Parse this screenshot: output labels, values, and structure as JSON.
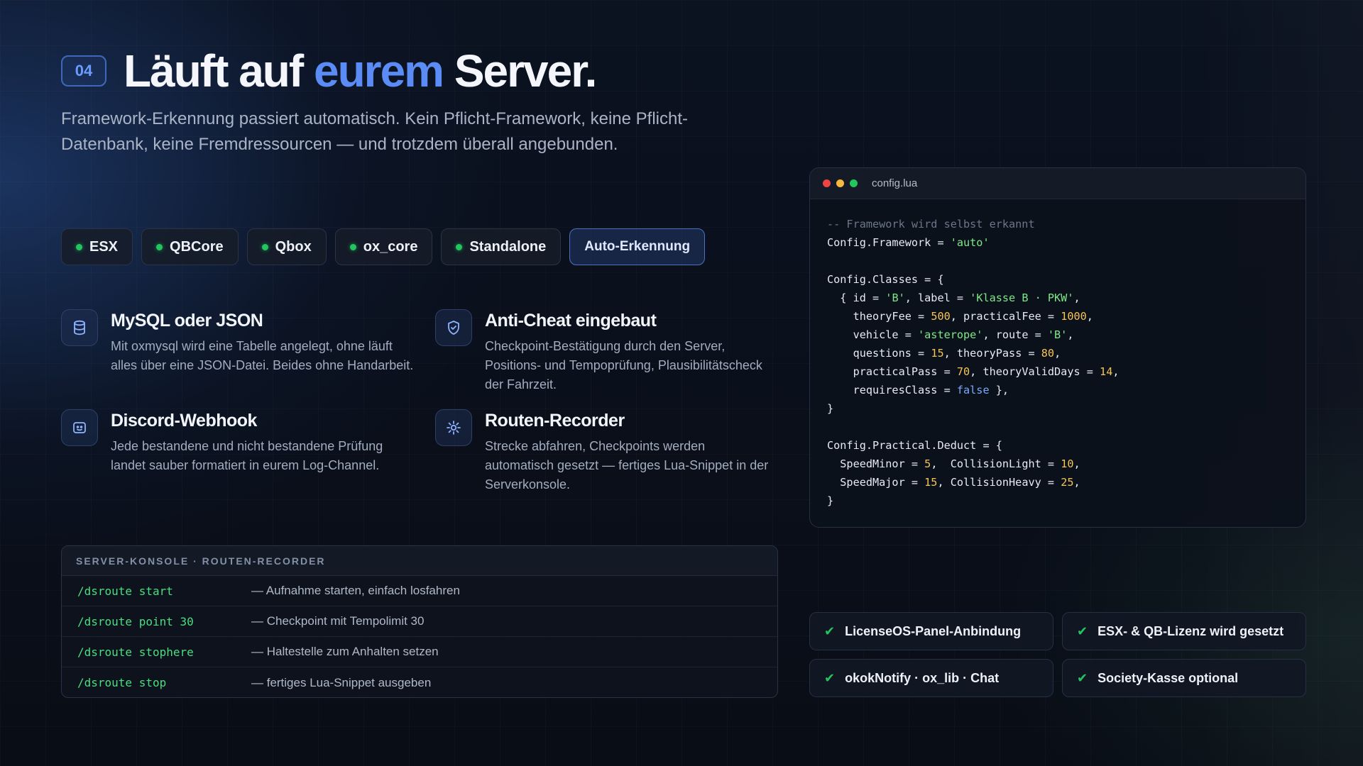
{
  "header": {
    "section_number": "04",
    "title_part1": "Läuft auf ",
    "title_accent": "eurem",
    "title_part2": " Server.",
    "subtitle": "Framework-Erkennung passiert automatisch. Kein Pflicht-Framework, keine Pflicht-Datenbank, keine Fremdressourcen — und trotzdem überall angebunden."
  },
  "frameworks": [
    {
      "label": "ESX"
    },
    {
      "label": "QBCore"
    },
    {
      "label": "Qbox"
    },
    {
      "label": "ox_core"
    },
    {
      "label": "Standalone"
    }
  ],
  "auto_chip": "Auto-Erkennung",
  "features": [
    {
      "icon": "database-icon",
      "title": "MySQL oder JSON",
      "text": "Mit oxmysql wird eine Tabelle angelegt, ohne läuft alles über eine JSON-Datei. Beides ohne Handarbeit."
    },
    {
      "icon": "shield-icon",
      "title": "Anti-Cheat eingebaut",
      "text": "Checkpoint-Bestätigung durch den Server, Positions- und Tempoprüfung, Plausibilitätscheck der Fahrzeit."
    },
    {
      "icon": "discord-icon",
      "title": "Discord-Webhook",
      "text": "Jede bestandene und nicht bestandene Prüfung landet sauber formatiert in eurem Log-Channel."
    },
    {
      "icon": "route-icon",
      "title": "Routen-Recorder",
      "text": "Strecke abfahren, Checkpoints werden automatisch gesetzt — fertiges Lua-Snippet in der Serverkonsole."
    }
  ],
  "console": {
    "header": "SERVER-KONSOLE · ROUTEN-RECORDER",
    "rows": [
      {
        "cmd": "/dsroute start",
        "desc": "— Aufnahme starten, einfach losfahren"
      },
      {
        "cmd": "/dsroute point 30",
        "desc": "— Checkpoint mit Tempolimit 30"
      },
      {
        "cmd": "/dsroute stophere",
        "desc": "— Haltestelle zum Anhalten setzen"
      },
      {
        "cmd": "/dsroute stop",
        "desc": "— fertiges Lua-Snippet ausgeben"
      }
    ]
  },
  "code_window": {
    "filename": "config.lua",
    "colors": {
      "red": "#ef4444",
      "yellow": "#f5b93b",
      "green": "#22c55e"
    },
    "lines": [
      [
        {
          "t": "-- Framework wird selbst erkannt",
          "c": "cm"
        }
      ],
      [
        {
          "t": "Config.Framework = "
        },
        {
          "t": "'auto'",
          "c": "st"
        }
      ],
      [],
      [
        {
          "t": "Config.Classes = {"
        }
      ],
      [
        {
          "t": "  { id = "
        },
        {
          "t": "'B'",
          "c": "st"
        },
        {
          "t": ", label = "
        },
        {
          "t": "'Klasse B · PKW'",
          "c": "st"
        },
        {
          "t": ","
        }
      ],
      [
        {
          "t": "    theoryFee = "
        },
        {
          "t": "500",
          "c": "nu"
        },
        {
          "t": ", practicalFee = "
        },
        {
          "t": "1000",
          "c": "nu"
        },
        {
          "t": ","
        }
      ],
      [
        {
          "t": "    vehicle = "
        },
        {
          "t": "'asterope'",
          "c": "st"
        },
        {
          "t": ", route = "
        },
        {
          "t": "'B'",
          "c": "st"
        },
        {
          "t": ","
        }
      ],
      [
        {
          "t": "    questions = "
        },
        {
          "t": "15",
          "c": "nu"
        },
        {
          "t": ", theoryPass = "
        },
        {
          "t": "80",
          "c": "nu"
        },
        {
          "t": ","
        }
      ],
      [
        {
          "t": "    practicalPass = "
        },
        {
          "t": "70",
          "c": "nu"
        },
        {
          "t": ", theoryValidDays = "
        },
        {
          "t": "14",
          "c": "nu"
        },
        {
          "t": ","
        }
      ],
      [
        {
          "t": "    requiresClass = "
        },
        {
          "t": "false",
          "c": "kw"
        },
        {
          "t": " },"
        }
      ],
      [
        {
          "t": "}"
        }
      ],
      [],
      [
        {
          "t": "Config.Practical.Deduct = {"
        }
      ],
      [
        {
          "t": "  SpeedMinor = "
        },
        {
          "t": "5",
          "c": "nu"
        },
        {
          "t": ",  CollisionLight = "
        },
        {
          "t": "10",
          "c": "nu"
        },
        {
          "t": ","
        }
      ],
      [
        {
          "t": "  SpeedMajor = "
        },
        {
          "t": "15",
          "c": "nu"
        },
        {
          "t": ", CollisionHeavy = "
        },
        {
          "t": "25",
          "c": "nu"
        },
        {
          "t": ","
        }
      ],
      [
        {
          "t": "}"
        }
      ]
    ]
  },
  "badges": [
    {
      "label": "LicenseOS-Panel-Anbindung"
    },
    {
      "label": "ESX- & QB-Lizenz wird gesetzt"
    },
    {
      "label": "okokNotify · ox_lib · Chat"
    },
    {
      "label": "Society-Kasse optional"
    }
  ],
  "check_glyph": "✔"
}
